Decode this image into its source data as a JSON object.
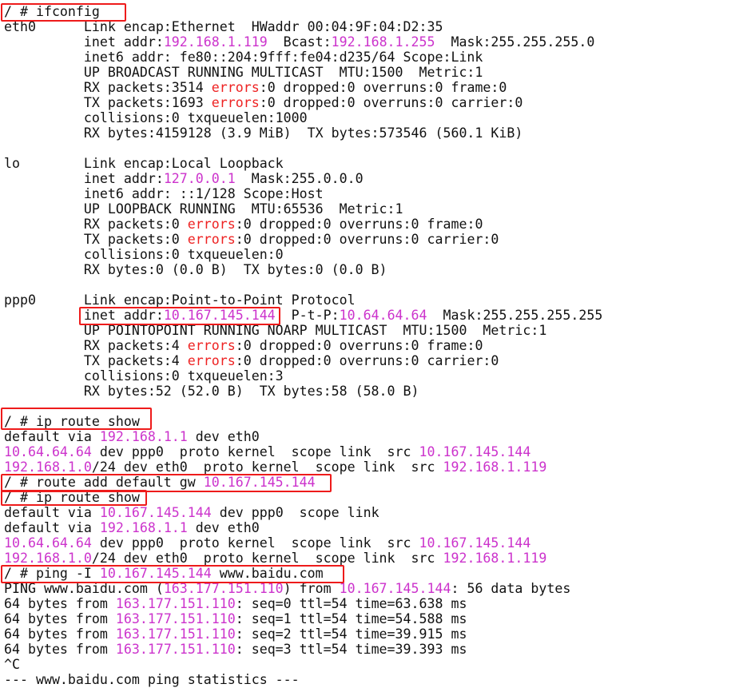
{
  "colors": {
    "background": "#ffffff",
    "text": "#111111",
    "ip_highlight": "#cc33cc",
    "error_highlight": "#ee2222",
    "annotation_box": "#ee1b1b"
  },
  "lines": [
    [
      {
        "t": "/ # ifconfig"
      }
    ],
    [
      {
        "t": "eth0      Link encap:Ethernet  HWaddr 00:04:9F:04:D2:35"
      }
    ],
    [
      {
        "t": "          inet addr:"
      },
      {
        "t": "192.168.1.119",
        "c": "magenta"
      },
      {
        "t": "  Bcast:"
      },
      {
        "t": "192.168.1.255",
        "c": "magenta"
      },
      {
        "t": "  Mask:255.255.255.0"
      }
    ],
    [
      {
        "t": "          inet6 addr: fe80::204:9fff:fe04:d235/64 Scope:Link"
      }
    ],
    [
      {
        "t": "          UP BROADCAST RUNNING MULTICAST  MTU:1500  Metric:1"
      }
    ],
    [
      {
        "t": "          RX packets:3514 "
      },
      {
        "t": "errors",
        "c": "red"
      },
      {
        "t": ":0 dropped:0 overruns:0 frame:0"
      }
    ],
    [
      {
        "t": "          TX packets:1693 "
      },
      {
        "t": "errors",
        "c": "red"
      },
      {
        "t": ":0 dropped:0 overruns:0 carrier:0"
      }
    ],
    [
      {
        "t": "          collisions:0 txqueuelen:1000"
      }
    ],
    [
      {
        "t": "          RX bytes:4159128 (3.9 MiB)  TX bytes:573546 (560.1 KiB)"
      }
    ],
    [
      {
        "t": ""
      }
    ],
    [
      {
        "t": "lo        Link encap:Local Loopback"
      }
    ],
    [
      {
        "t": "          inet addr:"
      },
      {
        "t": "127.0.0.1",
        "c": "magenta"
      },
      {
        "t": "  Mask:255.0.0.0"
      }
    ],
    [
      {
        "t": "          inet6 addr: ::1/128 Scope:Host"
      }
    ],
    [
      {
        "t": "          UP LOOPBACK RUNNING  MTU:65536  Metric:1"
      }
    ],
    [
      {
        "t": "          RX packets:0 "
      },
      {
        "t": "errors",
        "c": "red"
      },
      {
        "t": ":0 dropped:0 overruns:0 frame:0"
      }
    ],
    [
      {
        "t": "          TX packets:0 "
      },
      {
        "t": "errors",
        "c": "red"
      },
      {
        "t": ":0 dropped:0 overruns:0 carrier:0"
      }
    ],
    [
      {
        "t": "          collisions:0 txqueuelen:0"
      }
    ],
    [
      {
        "t": "          RX bytes:0 (0.0 B)  TX bytes:0 (0.0 B)"
      }
    ],
    [
      {
        "t": ""
      }
    ],
    [
      {
        "t": "ppp0      Link encap:Point-to-Point Protocol"
      }
    ],
    [
      {
        "t": "          inet addr:"
      },
      {
        "t": "10.167.145.144",
        "c": "magenta"
      },
      {
        "t": "  P-t-P:"
      },
      {
        "t": "10.64.64.64",
        "c": "magenta"
      },
      {
        "t": "  Mask:255.255.255.255"
      }
    ],
    [
      {
        "t": "          UP POINTOPOINT RUNNING NOARP MULTICAST  MTU:1500  Metric:1"
      }
    ],
    [
      {
        "t": "          RX packets:4 "
      },
      {
        "t": "errors",
        "c": "red"
      },
      {
        "t": ":0 dropped:0 overruns:0 frame:0"
      }
    ],
    [
      {
        "t": "          TX packets:4 "
      },
      {
        "t": "errors",
        "c": "red"
      },
      {
        "t": ":0 dropped:0 overruns:0 carrier:0"
      }
    ],
    [
      {
        "t": "          collisions:0 txqueuelen:3"
      }
    ],
    [
      {
        "t": "          RX bytes:52 (52.0 B)  TX bytes:58 (58.0 B)"
      }
    ],
    [
      {
        "t": ""
      }
    ],
    [
      {
        "t": "/ # ip route show"
      }
    ],
    [
      {
        "t": "default via "
      },
      {
        "t": "192.168.1.1",
        "c": "magenta"
      },
      {
        "t": " dev eth0"
      }
    ],
    [
      {
        "t": "10.64.64.64",
        "c": "magenta"
      },
      {
        "t": " dev ppp0  proto kernel  scope link  src "
      },
      {
        "t": "10.167.145.144",
        "c": "magenta"
      }
    ],
    [
      {
        "t": "192.168.1.0",
        "c": "magenta"
      },
      {
        "t": "/24 dev eth0  proto kernel  scope link  src "
      },
      {
        "t": "192.168.1.119",
        "c": "magenta"
      }
    ],
    [
      {
        "t": "/ # route add default gw "
      },
      {
        "t": "10.167.145.144",
        "c": "magenta"
      }
    ],
    [
      {
        "t": "/ # ip route show"
      }
    ],
    [
      {
        "t": "default via "
      },
      {
        "t": "10.167.145.144",
        "c": "magenta"
      },
      {
        "t": " dev ppp0  scope link"
      }
    ],
    [
      {
        "t": "default via "
      },
      {
        "t": "192.168.1.1",
        "c": "magenta"
      },
      {
        "t": " dev eth0"
      }
    ],
    [
      {
        "t": "10.64.64.64",
        "c": "magenta"
      },
      {
        "t": " dev ppp0  proto kernel  scope link  src "
      },
      {
        "t": "10.167.145.144",
        "c": "magenta"
      }
    ],
    [
      {
        "t": "192.168.1.0",
        "c": "magenta"
      },
      {
        "t": "/24 dev eth0  proto kernel  scope link  src "
      },
      {
        "t": "192.168.1.119",
        "c": "magenta"
      }
    ],
    [
      {
        "t": "/ # ping -I "
      },
      {
        "t": "10.167.145.144",
        "c": "magenta"
      },
      {
        "t": " www.baidu.com"
      }
    ],
    [
      {
        "t": "PING www.baidu.com ("
      },
      {
        "t": "163.177.151.110",
        "c": "magenta"
      },
      {
        "t": ") from "
      },
      {
        "t": "10.167.145.144",
        "c": "magenta"
      },
      {
        "t": ": 56 data bytes"
      }
    ],
    [
      {
        "t": "64 bytes from "
      },
      {
        "t": "163.177.151.110",
        "c": "magenta"
      },
      {
        "t": ": seq=0 ttl=54 time=63.638 ms"
      }
    ],
    [
      {
        "t": "64 bytes from "
      },
      {
        "t": "163.177.151.110",
        "c": "magenta"
      },
      {
        "t": ": seq=1 ttl=54 time=54.588 ms"
      }
    ],
    [
      {
        "t": "64 bytes from "
      },
      {
        "t": "163.177.151.110",
        "c": "magenta"
      },
      {
        "t": ": seq=2 ttl=54 time=39.915 ms"
      }
    ],
    [
      {
        "t": "64 bytes from "
      },
      {
        "t": "163.177.151.110",
        "c": "magenta"
      },
      {
        "t": ": seq=3 ttl=54 time=39.393 ms"
      }
    ],
    [
      {
        "t": "^C"
      }
    ],
    [
      {
        "t": "--- www.baidu.com ping statistics ---"
      }
    ]
  ]
}
